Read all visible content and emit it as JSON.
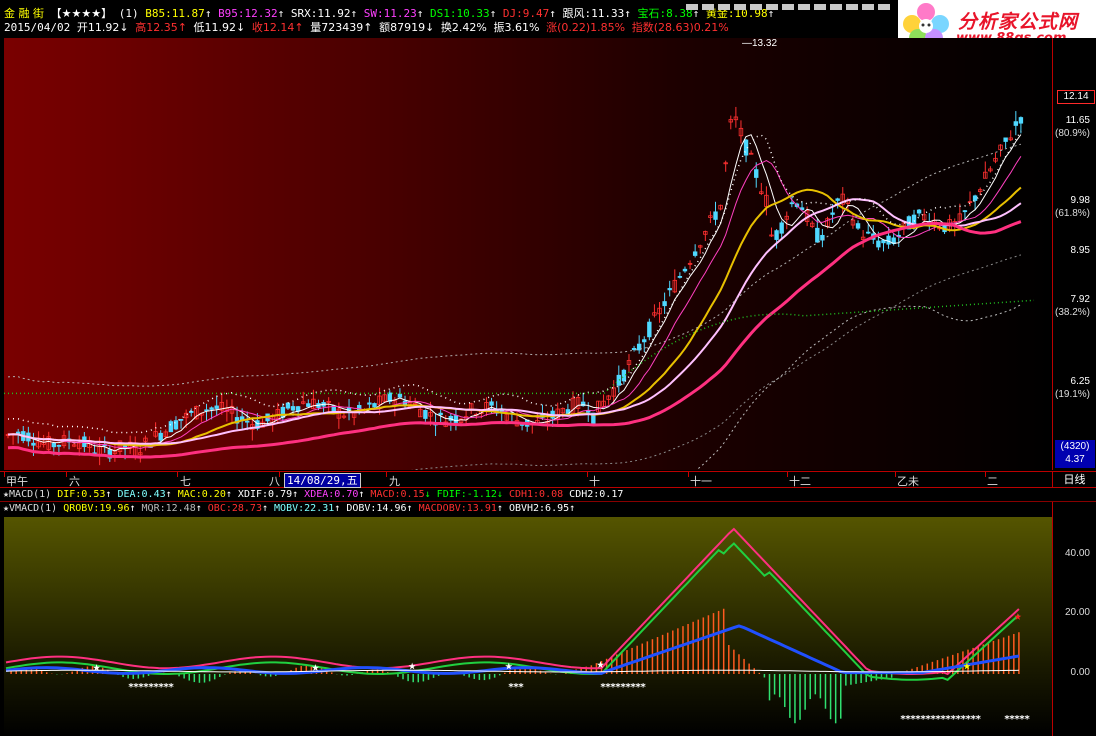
{
  "header": {
    "stock_name": "金 融 街",
    "rating": "【★★★★】",
    "period_flag": "(1)",
    "indicators": [
      {
        "label": "B85:11.87",
        "arrow": "↑",
        "color": "#ffff00"
      },
      {
        "label": "B95:12.32",
        "arrow": "↑",
        "color": "#ff40ff"
      },
      {
        "label": "SRX:11.92",
        "arrow": "↑",
        "color": "#ffffff"
      },
      {
        "label": "SW:11.23",
        "arrow": "↑",
        "color": "#ff40ff"
      },
      {
        "label": "DS1:10.33",
        "arrow": "↑",
        "color": "#00ff00"
      },
      {
        "label": "DJ:9.47",
        "arrow": "↑",
        "color": "#ff3030"
      },
      {
        "label": "跟风:11.33",
        "arrow": "↑",
        "color": "#ffffff"
      },
      {
        "label": "宝石:8.38",
        "arrow": "↑",
        "color": "#00ff00"
      },
      {
        "label": "黄金:10.98",
        "arrow": "↑",
        "color": "#ffff00"
      }
    ],
    "quote": {
      "date": "2015/04/02",
      "open": "开11.92↓",
      "high": "高12.35↑",
      "low": "低11.92↓",
      "close": "收12.14↑",
      "volume": "量723439↑",
      "amount": "额87919↓",
      "turnover": "换2.42%",
      "amplitude": "振3.61%",
      "change": "涨(0.22)1.85%",
      "index": "指数(28.63)0.21%"
    }
  },
  "brand": {
    "name": "分析家公式网",
    "url": "www.88gs.com"
  },
  "main_chart": {
    "peak_label": "13.32",
    "current_price": "12.14",
    "price_levels": [
      "11.65",
      "9.98",
      "8.95",
      "7.92",
      "6.25"
    ],
    "pct_levels": [
      "(80.9%)",
      "(61.8%)",
      "(38.2%)",
      "(19.1%)"
    ],
    "position_box": {
      "line1": "(4320)",
      "line2": "4.37"
    }
  },
  "date_axis": {
    "labels": [
      "甲午",
      "六",
      "七",
      "八",
      "九",
      "十",
      "十一",
      "十二",
      "乙未",
      "二"
    ],
    "selected_date": "14/08/29,五",
    "period": "日线"
  },
  "macd_bar": {
    "name": "MACD(1)",
    "items": [
      {
        "label": "DIF:0.53",
        "arrow": "↑",
        "color": "#ffff00"
      },
      {
        "label": "DEA:0.43",
        "arrow": "↑",
        "color": "#80ffff"
      },
      {
        "label": "MAC:0.20",
        "arrow": "↑",
        "color": "#ffff00"
      },
      {
        "label": "XDIF:0.79",
        "arrow": "↑",
        "color": "#ffffff"
      },
      {
        "label": "XDEA:0.70",
        "arrow": "↑",
        "color": "#ff40ff"
      },
      {
        "label": "MACD:0.15",
        "arrow": "↓",
        "color": "#ff3030"
      },
      {
        "label": "FDIF:-1.12",
        "arrow": "↓",
        "color": "#00ff00"
      },
      {
        "label": "CDH1:0.08",
        "arrow": "",
        "color": "#ff3030"
      },
      {
        "label": "CDH2:0.17",
        "arrow": "",
        "color": "#ffffff"
      }
    ]
  },
  "vmacd_bar": {
    "name": "VMACD(1)",
    "items": [
      {
        "label": "QROBV:19.96",
        "arrow": "↑",
        "color": "#ffff00"
      },
      {
        "label": "MQR:12.48",
        "arrow": "↑",
        "color": "#bbbbbb"
      },
      {
        "label": "OBC:28.73",
        "arrow": "↑",
        "color": "#ff3030"
      },
      {
        "label": "MOBV:22.31",
        "arrow": "↑",
        "color": "#80ffff"
      },
      {
        "label": "DOBV:14.96",
        "arrow": "↑",
        "color": "#ffffff"
      },
      {
        "label": "MACDOBV:13.91",
        "arrow": "↑",
        "color": "#ff3030"
      },
      {
        "label": "OBVH2:6.95",
        "arrow": "↑",
        "color": "#ffffff"
      }
    ]
  },
  "sub_chart": {
    "levels": [
      "40.00",
      "20.00",
      "0.00"
    ],
    "star_groups": [
      "*********",
      "***",
      "*********",
      "****************",
      "*****"
    ]
  },
  "colors": {
    "up": "#ff3030",
    "down": "#4fd8ff",
    "ma_yellow": "#e8c000",
    "ma_pink": "#ff3080",
    "ma_white": "#ffc0ff",
    "signal_green": "#20c020"
  }
}
